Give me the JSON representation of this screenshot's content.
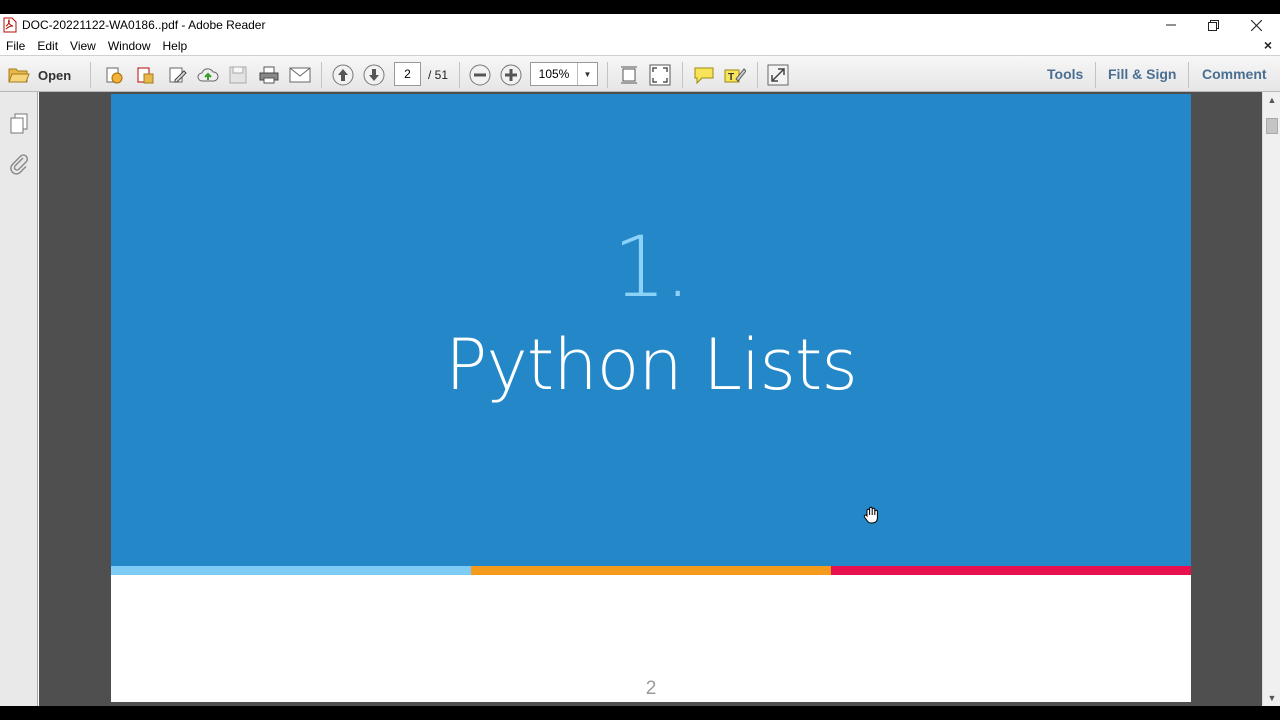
{
  "window": {
    "title": "DOC-20221122-WA0186..pdf - Adobe Reader",
    "controls": [
      "minimize-icon",
      "restore-icon",
      "close-icon"
    ]
  },
  "menu": {
    "items": [
      "File",
      "Edit",
      "View",
      "Window",
      "Help"
    ],
    "close_glyph": "×"
  },
  "toolbar": {
    "open_label": "Open",
    "current_page": "2",
    "page_total": "/  51",
    "zoom": "105%",
    "right_tabs": {
      "tools": "Tools",
      "fill_sign": "Fill & Sign",
      "comment": "Comment"
    },
    "icons": [
      "folder-icon",
      "create-pdf-icon",
      "export-pdf-icon",
      "edit-icon",
      "upload-cloud-icon",
      "save-icon",
      "print-icon",
      "email-icon",
      "prev-page-icon",
      "next-page-icon",
      "zoom-out-icon",
      "zoom-in-icon",
      "fit-page-icon",
      "fit-width-icon",
      "sticky-note-icon",
      "highlight-icon",
      "fullscreen-icon"
    ]
  },
  "slide": {
    "number": "1.",
    "title": "Python Lists",
    "page_number": "2",
    "colors": {
      "background": "#2387c8",
      "number": "#8cd2f7",
      "stripe_1": "#7ecbf5",
      "stripe_2": "#f49a1c",
      "stripe_3": "#e8114f"
    }
  }
}
